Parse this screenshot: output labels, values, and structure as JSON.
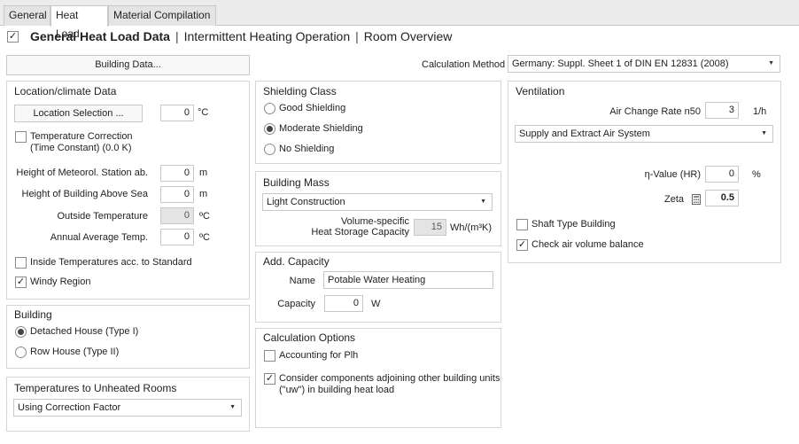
{
  "tabs": [
    "General",
    "Heat Load",
    "Material Compilation"
  ],
  "subnav": {
    "checked": true,
    "items": [
      "General Heat Load Data",
      "Intermittent Heating Operation",
      "Room Overview"
    ],
    "separator": "|"
  },
  "building_data_button": "Building Data...",
  "calc_method": {
    "label": "Calculation Method",
    "value": "Germany: Suppl. Sheet 1 of DIN EN 12831 (2008)"
  },
  "location": {
    "title": "Location/climate Data",
    "selection_button": "Location Selection ...",
    "selection_temp": "0",
    "selection_unit": "°C",
    "temp_correction_label": "Temperature Correction",
    "temp_correction_sub": "(Time Constant) (0.0 K)",
    "meteorol_label": "Height of Meteorol. Station ab.",
    "meteorol_value": "0",
    "meteorol_unit": "m",
    "building_height_label": "Height of Building Above Sea",
    "building_height_value": "0",
    "building_height_unit": "m",
    "outside_temp_label": "Outside Temperature",
    "outside_temp_value": "0",
    "outside_temp_unit": "ºC",
    "annual_temp_label": "Annual Average Temp.",
    "annual_temp_value": "0",
    "annual_temp_unit": "ºC",
    "inside_temps_label": "Inside Temperatures acc. to Standard",
    "windy_label": "Windy Region"
  },
  "building": {
    "title": "Building",
    "options": [
      "Detached House (Type I)",
      "Row House (Type II)"
    ]
  },
  "unheated": {
    "title": "Temperatures to Unheated Rooms",
    "value": "Using Correction Factor"
  },
  "shielding": {
    "title": "Shielding Class",
    "options": [
      "Good Shielding",
      "Moderate Shielding",
      "No Shielding"
    ]
  },
  "mass": {
    "title": "Building Mass",
    "value": "Light Construction",
    "storage_label_1": "Volume-specific",
    "storage_label_2": "Heat Storage Capacity",
    "storage_value": "15",
    "storage_unit": "Wh/(m³K)"
  },
  "add_capacity": {
    "title": "Add. Capacity",
    "name_label": "Name",
    "name_value": "Potable Water Heating",
    "capacity_label": "Capacity",
    "capacity_value": "0",
    "capacity_unit": "W"
  },
  "calc_options": {
    "title": "Calculation Options",
    "plh_label": "Accounting for Plh",
    "consider_label_1": "Consider components adjoining other building units",
    "consider_label_2": "(\"uw\") in building heat load"
  },
  "ventilation": {
    "title": "Ventilation",
    "air_change_label": "Air Change Rate n50",
    "air_change_value": "3",
    "air_change_unit": "1/h",
    "system_value": "Supply and Extract Air System",
    "eta_label": "η-Value (HR)",
    "eta_value": "0",
    "eta_unit": "%",
    "zeta_label": "Zeta",
    "zeta_value": "0.5",
    "shaft_label": "Shaft Type Building",
    "balance_label": "Check air volume balance"
  },
  "glyphs": {
    "check": "✓",
    "dropdown": "▼"
  }
}
